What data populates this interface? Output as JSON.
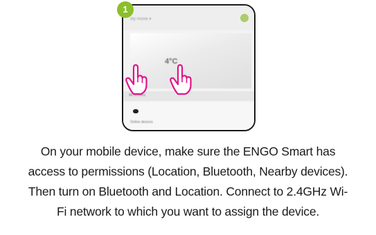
{
  "step": {
    "number": "1",
    "badge_color": "#8bbf2b"
  },
  "phone": {
    "header_label": "My Home ▾",
    "temperature": "4°C",
    "tab_label": "All devices",
    "device_label": "Online devices",
    "accent": "#9bc44a"
  },
  "gesture": {
    "icon": "hand-tap-icon",
    "color": "#e0148c"
  },
  "caption": {
    "lines": [
      "On your mobile device, make sure the ENGO Smart has",
      "access to permissions (Location, Bluetooth, Nearby devices).",
      "Then turn on Bluetooth and Location. Connect to 2.4GHz Wi-",
      "Fi network to which you want to assign the device."
    ]
  }
}
